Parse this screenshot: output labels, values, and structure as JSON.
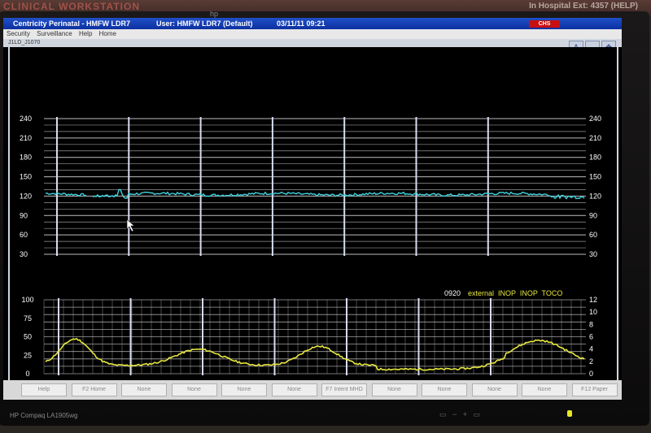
{
  "environment": {
    "wall_left": "CLINICAL WORKSTATION",
    "wall_right": "In Hospital Ext: 4357 (HELP)",
    "monitor_brand": "hp",
    "monitor_model": "HP Compaq LA1905wg"
  },
  "window": {
    "app_title": "Centricity Perinatal - HMFW LDR7",
    "user": "User: HMFW LDR7 (Default)",
    "datetime": "03/11/11 09:21",
    "logo": "CHS"
  },
  "menu": [
    "Security",
    "Surveillance",
    "Help",
    "Home"
  ],
  "panel": {
    "label": "J1LD_J1070"
  },
  "colors": {
    "fhr": "#3fd4e0",
    "toco": "#e8e840",
    "grid": "#c8c8c8",
    "major_grid": "#d8dcf0",
    "status": "#e8e840",
    "status_time": "#ffffff"
  },
  "fhr_strip": {
    "left_ticks": [
      "240",
      "210",
      "180",
      "150",
      "120",
      "90",
      "60",
      "30"
    ],
    "right_ticks": [
      "240",
      "210",
      "180",
      "150",
      "120",
      "90",
      "60",
      "30"
    ],
    "y_range": [
      30,
      240
    ],
    "baseline_bpm": 123
  },
  "toco_strip": {
    "left_ticks": [
      "100",
      "75",
      "50",
      "25",
      "0"
    ],
    "right_ticks": [
      "12",
      "10",
      "8",
      "6",
      "4",
      "2",
      "0"
    ],
    "y_range": [
      0,
      100
    ],
    "status_time": "0920",
    "status_text": "external  INOP  INOP  TOCO"
  },
  "function_keys": [
    "Help",
    "F2 Home",
    "None",
    "None",
    "None",
    "None",
    "F7 Intent MHD",
    "None",
    "None",
    "None",
    "None",
    "F12 Paper"
  ]
}
